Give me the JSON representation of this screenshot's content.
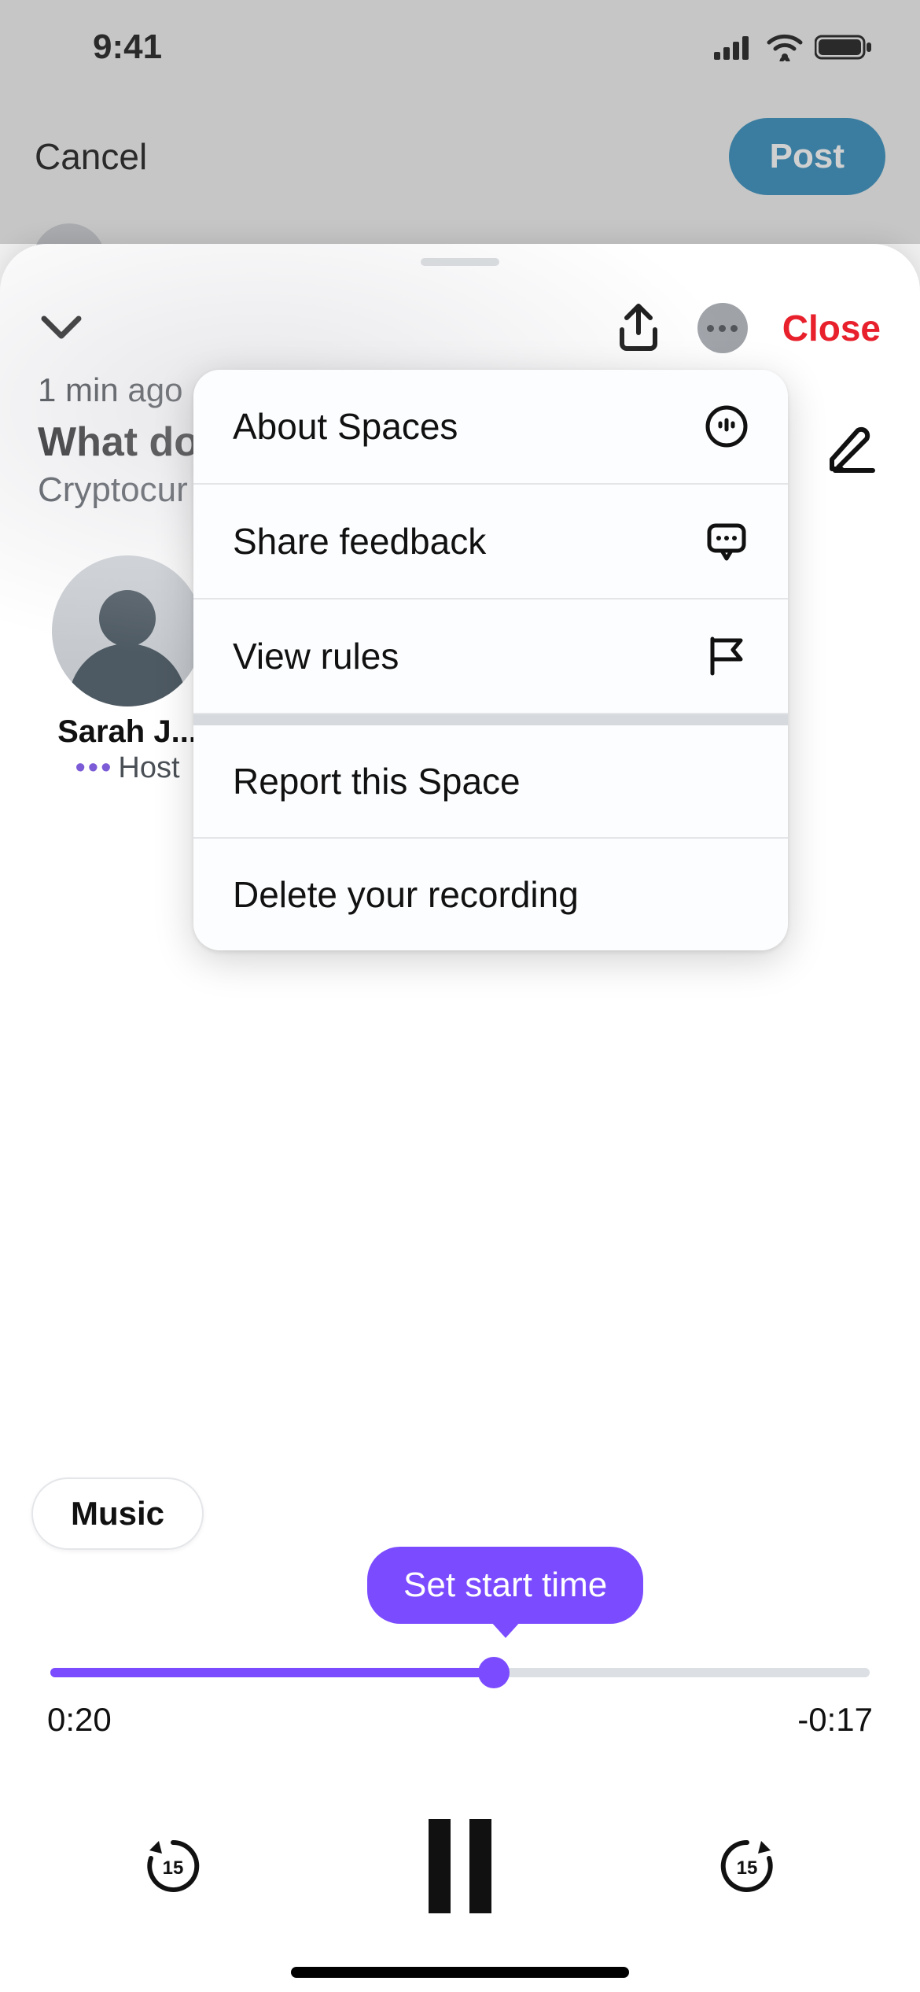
{
  "status": {
    "time": "9:41"
  },
  "topbar": {
    "cancel": "Cancel",
    "post": "Post"
  },
  "sheet": {
    "close": "Close",
    "timestamp": "1 min ago",
    "title": "What do",
    "topic": "Cryptocur",
    "host_name": "Sarah J...",
    "host_role": "Host"
  },
  "menu": {
    "about": "About Spaces",
    "feedback": "Share feedback",
    "rules": "View rules",
    "report": "Report this Space",
    "delete": "Delete your recording"
  },
  "player": {
    "music_label": "Music",
    "tooltip": "Set start time",
    "elapsed": "0:20",
    "remaining": "-0:17",
    "skip_seconds": "15"
  },
  "colors": {
    "accent_purple": "#7b4bff",
    "accent_blue": "#1b80b5",
    "danger": "#e8202c"
  }
}
